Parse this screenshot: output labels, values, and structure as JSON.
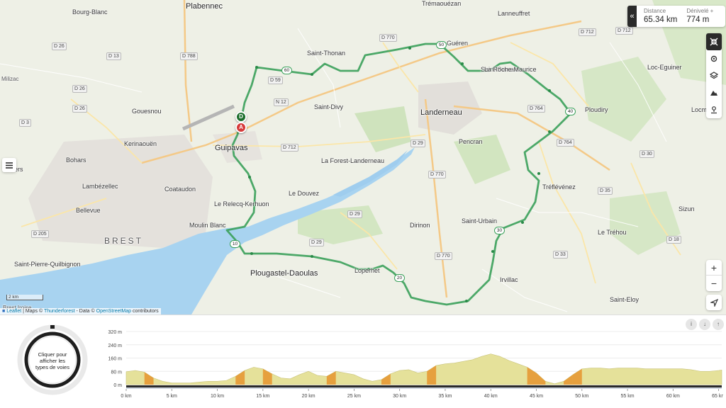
{
  "places": [
    {
      "name": "Plabennec",
      "cls": "big"
    },
    {
      "name": "Bourg-Blanc",
      "cls": ""
    },
    {
      "name": "Saint-Thonan",
      "cls": ""
    },
    {
      "name": "Guipavas",
      "cls": "big"
    },
    {
      "name": "Gouesnou",
      "cls": ""
    },
    {
      "name": "Kerinaouën",
      "cls": ""
    },
    {
      "name": "Bohars",
      "cls": ""
    },
    {
      "name": "Lambézellec",
      "cls": ""
    },
    {
      "name": "Coataudon",
      "cls": ""
    },
    {
      "name": "Bellevue",
      "cls": ""
    },
    {
      "name": "BREST",
      "cls": "brest"
    },
    {
      "name": "Saint-Pierre-Quilbignon",
      "cls": ""
    },
    {
      "name": "Le Relecq-Kerhuon",
      "cls": ""
    },
    {
      "name": "Moulin Blanc",
      "cls": ""
    },
    {
      "name": "Le Douvez",
      "cls": ""
    },
    {
      "name": "La Forest-Landerneau",
      "cls": ""
    },
    {
      "name": "Saint-Divy",
      "cls": ""
    },
    {
      "name": "Landerneau",
      "cls": "big"
    },
    {
      "name": "Pencran",
      "cls": ""
    },
    {
      "name": "Dirinon",
      "cls": ""
    },
    {
      "name": "Saint-Urbain",
      "cls": ""
    },
    {
      "name": "Plougastel-Daoulas",
      "cls": "big"
    },
    {
      "name": "Loperhet",
      "cls": ""
    },
    {
      "name": "Irvillac",
      "cls": ""
    },
    {
      "name": "Saint-Eloy",
      "cls": ""
    },
    {
      "name": "Le Tréhou",
      "cls": ""
    },
    {
      "name": "Sizun",
      "cls": ""
    },
    {
      "name": "Tréflévénez",
      "cls": ""
    },
    {
      "name": "Ploudiry",
      "cls": ""
    },
    {
      "name": "Loc-Eguiner",
      "cls": ""
    },
    {
      "name": "Lanneuffret",
      "cls": ""
    },
    {
      "name": "Trémaouézan",
      "cls": ""
    },
    {
      "name": "Saint-Servais",
      "cls": ""
    },
    {
      "name": "La Roche-Maurice",
      "cls": ""
    },
    {
      "name": "Milizac",
      "cls": "small"
    },
    {
      "name": "Locmé",
      "cls": ""
    },
    {
      "name": "Brest Iroise",
      "cls": "small"
    },
    {
      "name": "Guilers",
      "cls": ""
    },
    {
      "name": "Guéren",
      "cls": ""
    }
  ],
  "roads": [
    "D 26",
    "D 13",
    "D 788",
    "D 770",
    "D 59",
    "N 12",
    "D 712",
    "D 3",
    "D 712",
    "D 29",
    "D 770",
    "D 764",
    "D 712",
    "D 764",
    "D 30",
    "D 35",
    "D 29",
    "D 205",
    "D 29",
    "D 770",
    "D 33",
    "D 18",
    "D 26",
    "D 26"
  ],
  "km_markers": [
    "10",
    "20",
    "30",
    "40",
    "50",
    "60"
  ],
  "pins": {
    "start": "D",
    "end": "A"
  },
  "stats": {
    "distance_label": "Distance",
    "distance_value": "65.34 km",
    "elevation_label": "Dénivelé +",
    "elevation_value": "774 m"
  },
  "scale_label": "2 km",
  "attribution": {
    "leaflet": "Leaflet",
    "sep1": " | Maps © ",
    "thunderforest": "Thunderforest",
    "sep2": " - Data © ",
    "osm": "OpenStreetMap",
    "tail": " contributors"
  },
  "ring_text": "Cliquer pour afficher les types de voies",
  "icons": {
    "collapse": "double-chevron-left-icon",
    "tools": [
      "collapse-arrows-icon",
      "gear-icon",
      "layers-icon",
      "mountain-icon",
      "location-pin-icon"
    ],
    "zoom_in": "+",
    "zoom_out": "−"
  },
  "graph_tools": [
    "i",
    "↓",
    "↑"
  ],
  "colors": {
    "route": "#3aa05a",
    "water": "#a8d3f0",
    "elev_fill": "#e5e19a",
    "elev_steep": "#e58a1f",
    "start_pin": "#1c6e2c",
    "end_pin": "#d63a3a"
  },
  "chart_data": {
    "type": "area",
    "title": "",
    "xlabel": "",
    "ylabel": "",
    "x_ticks": [
      "0 km",
      "5 km",
      "10 km",
      "15 km",
      "20 km",
      "25 km",
      "30 km",
      "35 km",
      "40 km",
      "45 km",
      "50 km",
      "55 km",
      "60 km",
      "65 km"
    ],
    "y_ticks": [
      "0 m",
      "80 m",
      "160 m",
      "240 m",
      "320 m"
    ],
    "xlim": [
      0,
      65.34
    ],
    "ylim": [
      0,
      320
    ],
    "series": [
      {
        "x": [
          0,
          1,
          2,
          3,
          4,
          5,
          6,
          7,
          8,
          9,
          10,
          11,
          12,
          13,
          14,
          15,
          16,
          17,
          18,
          19,
          20,
          21,
          22,
          23,
          24,
          25,
          26,
          27,
          28,
          29,
          30,
          31,
          32,
          33,
          34,
          35,
          36,
          37,
          38,
          39,
          40,
          41,
          42,
          43,
          44,
          45,
          46,
          47,
          48,
          49,
          50,
          51,
          52,
          53,
          54,
          55,
          56,
          57,
          58,
          59,
          60,
          61,
          62,
          63,
          64,
          65,
          65.34
        ],
        "y": [
          78,
          85,
          75,
          40,
          20,
          10,
          10,
          10,
          15,
          20,
          20,
          25,
          50,
          85,
          105,
          95,
          65,
          40,
          35,
          60,
          80,
          55,
          50,
          80,
          70,
          60,
          35,
          20,
          30,
          65,
          85,
          90,
          70,
          80,
          115,
          125,
          130,
          140,
          150,
          170,
          185,
          170,
          145,
          125,
          105,
          70,
          20,
          5,
          20,
          60,
          95,
          100,
          100,
          95,
          100,
          100,
          100,
          95,
          95,
          95,
          95,
          95,
          90,
          80,
          80,
          85,
          88
        ]
      }
    ]
  }
}
